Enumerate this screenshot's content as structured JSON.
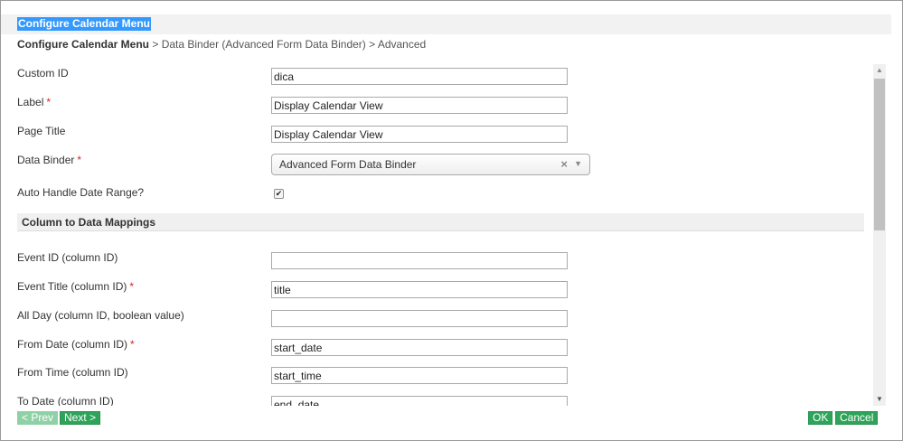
{
  "dialog": {
    "title": "Configure Calendar Menu"
  },
  "breadcrumb": {
    "root": "Configure Calendar Menu",
    "rest": "> Data Binder (Advanced Form Data Binder) > Advanced"
  },
  "fields": {
    "custom_id": {
      "label": "Custom ID",
      "value": "dica"
    },
    "label": {
      "label": "Label",
      "value": "Display Calendar View",
      "required": "*"
    },
    "page_title": {
      "label": "Page Title",
      "value": "Display Calendar View"
    },
    "data_binder": {
      "label": "Data Binder",
      "value": "Advanced Form Data Binder",
      "required": "*"
    },
    "auto_handle": {
      "label": "Auto Handle Date Range?",
      "checked": "✔"
    }
  },
  "section": {
    "title": "Column to Data Mappings"
  },
  "mappings": {
    "event_id": {
      "label": "Event ID (column ID)",
      "value": ""
    },
    "event_title": {
      "label": "Event Title (column ID)",
      "value": "title",
      "required": "*"
    },
    "all_day": {
      "label": "All Day (column ID, boolean value)",
      "value": ""
    },
    "from_date": {
      "label": "From Date (column ID)",
      "value": "start_date",
      "required": "*"
    },
    "from_time": {
      "label": "From Time (column ID)",
      "value": "start_time"
    },
    "to_date": {
      "label": "To Date (column ID)",
      "value": "end_date"
    }
  },
  "icons": {
    "clear": "×",
    "dropdown": "▼",
    "scroll_up": "▲",
    "scroll_down": "▼"
  },
  "footer": {
    "prev": "< Prev",
    "next": "Next >",
    "ok": "OK",
    "cancel": "Cancel"
  },
  "colors": {
    "title_highlight": "#3399ff",
    "button_green": "#2ea45a",
    "required": "#d9251d"
  }
}
